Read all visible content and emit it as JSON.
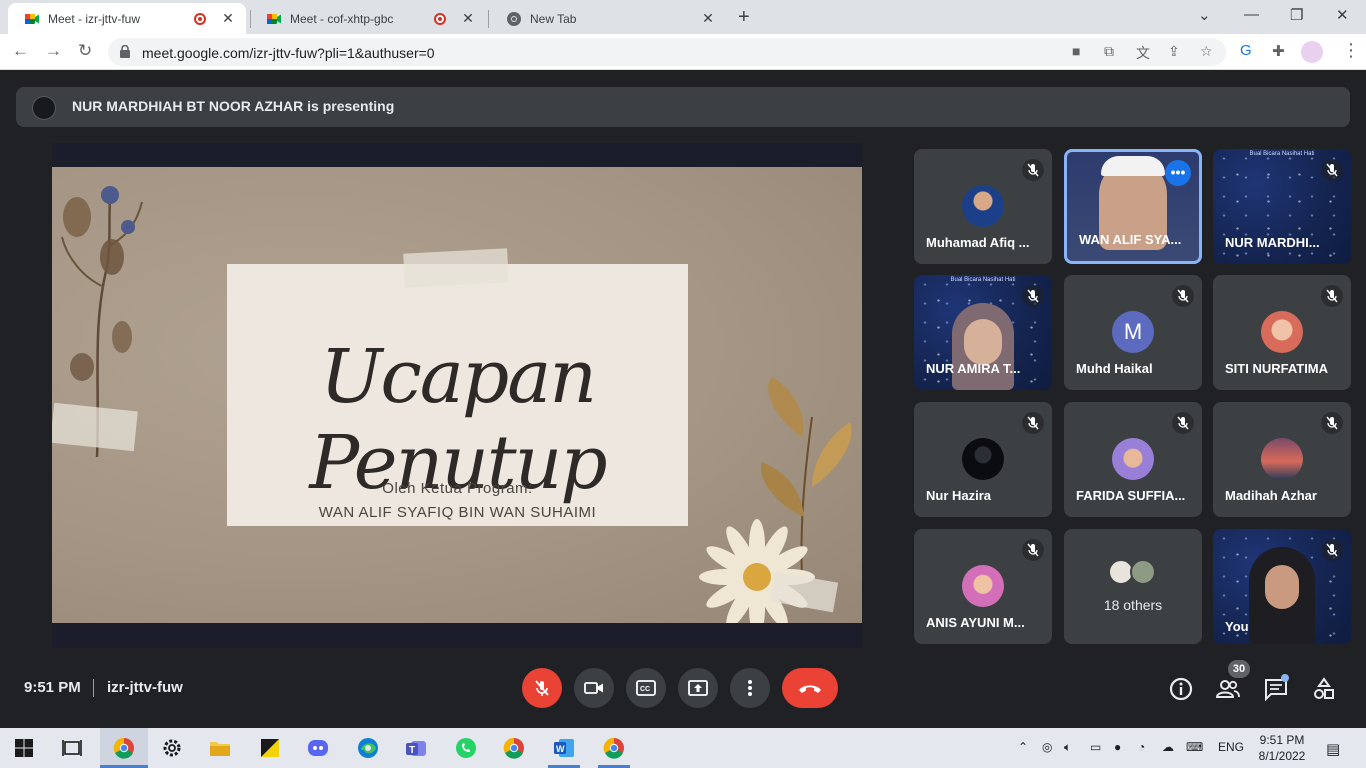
{
  "browser": {
    "tabs": [
      {
        "title": "Meet - izr-jttv-fuw",
        "recording": true,
        "active": true
      },
      {
        "title": "Meet - cof-xhtp-gbc",
        "recording": true,
        "active": false
      },
      {
        "title": "New Tab",
        "recording": false,
        "active": false
      }
    ],
    "url": "meet.google.com/izr-jttv-fuw?pli=1&authuser=0"
  },
  "meet": {
    "presenter_banner": "NUR MARDHIAH BT NOOR AZHAR is presenting",
    "slide": {
      "title": "Ucapan Penutup",
      "subtitle_line1": "Oleh Ketua Program:",
      "subtitle_line2": "WAN ALIF SYAFIQ BIN WAN SUHAIMI"
    },
    "participants": [
      {
        "name": "Muhamad Afiq ...",
        "muted": true,
        "highlighted": false
      },
      {
        "name": "WAN ALIF SYA...",
        "muted": false,
        "highlighted": true
      },
      {
        "name": "NUR MARDHI...",
        "muted": true,
        "highlighted": false
      },
      {
        "name": "NUR AMIRA T...",
        "muted": true,
        "highlighted": false
      },
      {
        "name": "Muhd Haikal",
        "muted": true,
        "avatar_letter": "M"
      },
      {
        "name": "SITI NURFATIMA",
        "muted": true
      },
      {
        "name": "Nur Hazira",
        "muted": true
      },
      {
        "name": "FARIDA SUFFIA...",
        "muted": true
      },
      {
        "name": "Madihah Azhar",
        "muted": true
      },
      {
        "name": "ANIS AYUNI M...",
        "muted": true
      },
      {
        "name": "18 others"
      },
      {
        "name": "You",
        "muted": true
      }
    ],
    "tile_overlay_text": "Bual Bicara Nasihat Hati",
    "time": "9:51 PM",
    "meeting_code": "izr-jttv-fuw",
    "people_count": "30"
  },
  "taskbar": {
    "language": "ENG",
    "time": "9:51 PM",
    "date": "8/1/2022"
  },
  "colors": {
    "meet_bg": "#202124",
    "tile_bg": "#3c4043",
    "danger": "#ea4335",
    "accent": "#8ab4f8"
  }
}
